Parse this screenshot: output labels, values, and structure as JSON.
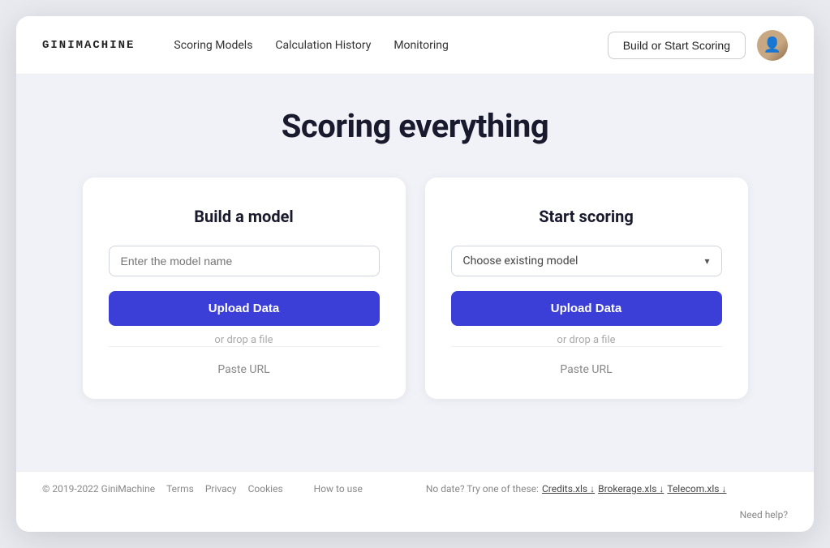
{
  "logo": "GINIMACHINE",
  "nav": {
    "links": [
      "Scoring Models",
      "Calculation History",
      "Monitoring"
    ],
    "cta_label": "Build or Start Scoring"
  },
  "page": {
    "title": "Scoring everything"
  },
  "build_card": {
    "title": "Build a model",
    "model_input_placeholder": "Enter the model name",
    "upload_button": "Upload Data",
    "drop_hint": "or drop a file",
    "paste_url": "Paste URL"
  },
  "score_card": {
    "title": "Start scoring",
    "model_select_placeholder": "Choose existing model",
    "upload_button": "Upload Data",
    "drop_hint": "or drop a file",
    "paste_url": "Paste URL"
  },
  "footer": {
    "copyright": "© 2019-2022 GiniMachine",
    "links": [
      "Terms",
      "Privacy",
      "Cookies"
    ],
    "how_to_use": "How to use",
    "try_text": "No date? Try one of these:",
    "files": [
      "Credits.xls ↓",
      "Brokerage.xls ↓",
      "Telecom.xls ↓"
    ],
    "need_help": "Need help?"
  }
}
